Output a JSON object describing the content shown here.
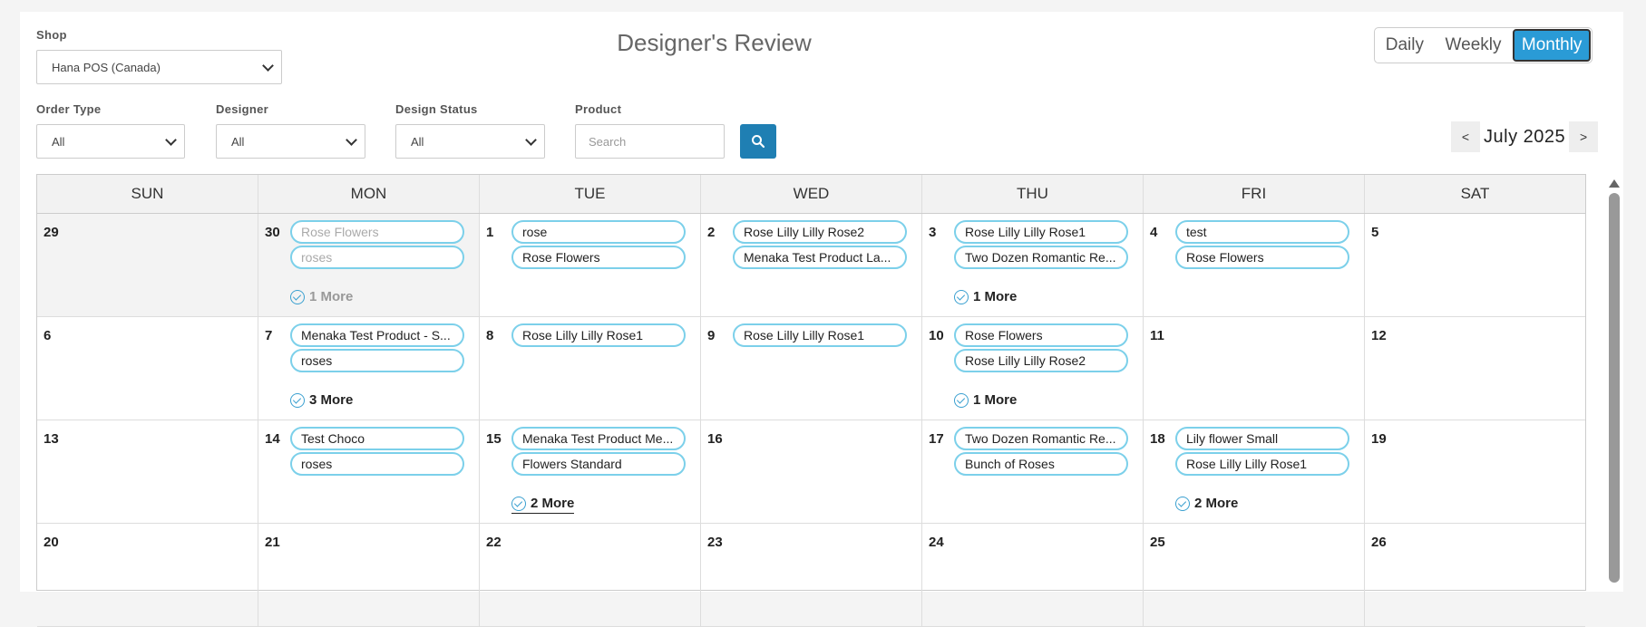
{
  "page": {
    "title": "Designer's Review"
  },
  "filters": {
    "shop": {
      "label": "Shop",
      "value": "Hana POS (Canada)"
    },
    "order_type": {
      "label": "Order Type",
      "value": "All"
    },
    "designer": {
      "label": "Designer",
      "value": "All"
    },
    "design_status": {
      "label": "Design Status",
      "value": "All"
    },
    "product": {
      "label": "Product",
      "placeholder": "Search"
    },
    "search_icon": "search-icon"
  },
  "view_toggle": {
    "daily": "Daily",
    "weekly": "Weekly",
    "monthly": "Monthly",
    "active": "Monthly"
  },
  "month_nav": {
    "prev": "<",
    "label": "July 2025",
    "next": ">"
  },
  "calendar": {
    "weekdays": [
      "SUN",
      "MON",
      "TUE",
      "WED",
      "THU",
      "FRI",
      "SAT"
    ],
    "weeks": [
      [
        {
          "day": "29",
          "other": true,
          "items": [],
          "more": ""
        },
        {
          "day": "30",
          "other": true,
          "items": [
            "Rose Flowers",
            "roses"
          ],
          "more": "1 More",
          "dim": true
        },
        {
          "day": "1",
          "items": [
            "rose",
            "Rose Flowers"
          ],
          "more": ""
        },
        {
          "day": "2",
          "items": [
            "Rose Lilly Lilly Rose2",
            "Menaka Test Product La..."
          ],
          "more": ""
        },
        {
          "day": "3",
          "items": [
            "Rose Lilly Lilly Rose1",
            "Two Dozen Romantic Re..."
          ],
          "more": "1 More"
        },
        {
          "day": "4",
          "items": [
            "test",
            "Rose Flowers"
          ],
          "more": ""
        },
        {
          "day": "5",
          "items": [],
          "more": ""
        }
      ],
      [
        {
          "day": "6",
          "items": [],
          "more": ""
        },
        {
          "day": "7",
          "items": [
            "Menaka Test Product - S...",
            "roses"
          ],
          "more": "3 More"
        },
        {
          "day": "8",
          "items": [
            "Rose Lilly Lilly Rose1"
          ],
          "more": ""
        },
        {
          "day": "9",
          "items": [
            "Rose Lilly Lilly Rose1"
          ],
          "more": ""
        },
        {
          "day": "10",
          "items": [
            "Rose Flowers",
            "Rose Lilly Lilly Rose2"
          ],
          "more": "1 More"
        },
        {
          "day": "11",
          "items": [],
          "more": ""
        },
        {
          "day": "12",
          "items": [],
          "more": ""
        }
      ],
      [
        {
          "day": "13",
          "items": [],
          "more": ""
        },
        {
          "day": "14",
          "items": [
            "Test Choco",
            "roses"
          ],
          "more": ""
        },
        {
          "day": "15",
          "items": [
            "Menaka Test Product Me...",
            "Flowers Standard"
          ],
          "more": "2 More",
          "underline": true
        },
        {
          "day": "16",
          "items": [],
          "more": ""
        },
        {
          "day": "17",
          "items": [
            "Two Dozen Romantic Re...",
            "Bunch of Roses"
          ],
          "more": ""
        },
        {
          "day": "18",
          "items": [
            "Lily flower Small",
            "Rose Lilly Lilly Rose1"
          ],
          "more": "2 More"
        },
        {
          "day": "19",
          "items": [],
          "more": ""
        }
      ],
      [
        {
          "day": "20",
          "items": [],
          "more": ""
        },
        {
          "day": "21",
          "items": [],
          "more": ""
        },
        {
          "day": "22",
          "items": [],
          "more": ""
        },
        {
          "day": "23",
          "items": [],
          "more": ""
        },
        {
          "day": "24",
          "items": [],
          "more": ""
        },
        {
          "day": "25",
          "items": [],
          "more": ""
        },
        {
          "day": "26",
          "items": [],
          "more": ""
        }
      ]
    ]
  },
  "colors": {
    "accent": "#2a9bd6",
    "search_button": "#1f7fb3",
    "pill_border": "#7cd0ea"
  }
}
